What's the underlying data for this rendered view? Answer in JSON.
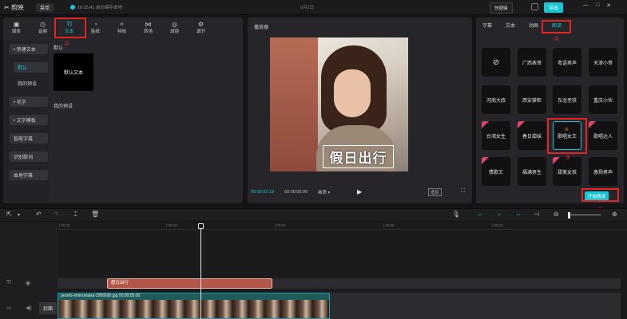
{
  "app": {
    "logo": "剪映",
    "menu": "菜单",
    "save_status": "10:25:41 自动保存本地",
    "project_title": "6月2日",
    "shortcut": "快捷键",
    "export": "导出",
    "window_controls": [
      "—",
      "□",
      "✕"
    ]
  },
  "tool_tabs": [
    {
      "label": "媒体",
      "icon": "▣"
    },
    {
      "label": "音频",
      "icon": "◷"
    },
    {
      "label": "文本",
      "icon": "TI"
    },
    {
      "label": "贴纸",
      "icon": "◔"
    },
    {
      "label": "特效",
      "icon": "✧"
    },
    {
      "label": "转场",
      "icon": "⋈"
    },
    {
      "label": "滤镜",
      "icon": "◎"
    },
    {
      "label": "调节",
      "icon": "⚙"
    }
  ],
  "text_sidebar": [
    "• 新建文本",
    "默认",
    "我的预设",
    "• 花字",
    "• 文字模板",
    "智能字幕",
    "识别歌词",
    "本地字幕"
  ],
  "text_content": {
    "section_default": "默认",
    "default_card": "默认文本",
    "section_presets": "我的预设"
  },
  "player": {
    "title": "播放器",
    "overlay_text": "假日出行",
    "current_time": "00:00:02:19",
    "total_time": "00:00:05:00",
    "quality": "画质 ▾",
    "ratio": "适应"
  },
  "right_tabs": [
    "字幕",
    "文本",
    "动画",
    "朗读"
  ],
  "voices": [
    "⊘",
    "广西表哥",
    "粤语男声",
    "天津小哥",
    "河南大叔",
    "西安掌柜",
    "东北老铁",
    "重庆小伙",
    "台湾女生",
    "春日甜妹",
    "歌唱女王",
    "歌唱达人",
    "情歌王",
    "福满男生",
    "甜美女孩",
    "激扬男声"
  ],
  "start_read": "开始朗读",
  "annotations": [
    "①",
    "②",
    "③",
    "④"
  ],
  "timeline": {
    "ticks": [
      "| 00:00",
      "| 00:02",
      "| 00:04",
      "| 00:06",
      "| 00:08"
    ],
    "text_clip": "假日出行",
    "video_clip_label": "pexels-eminumana-2956690.jpg  00:00:05:00",
    "cover": "封面"
  }
}
